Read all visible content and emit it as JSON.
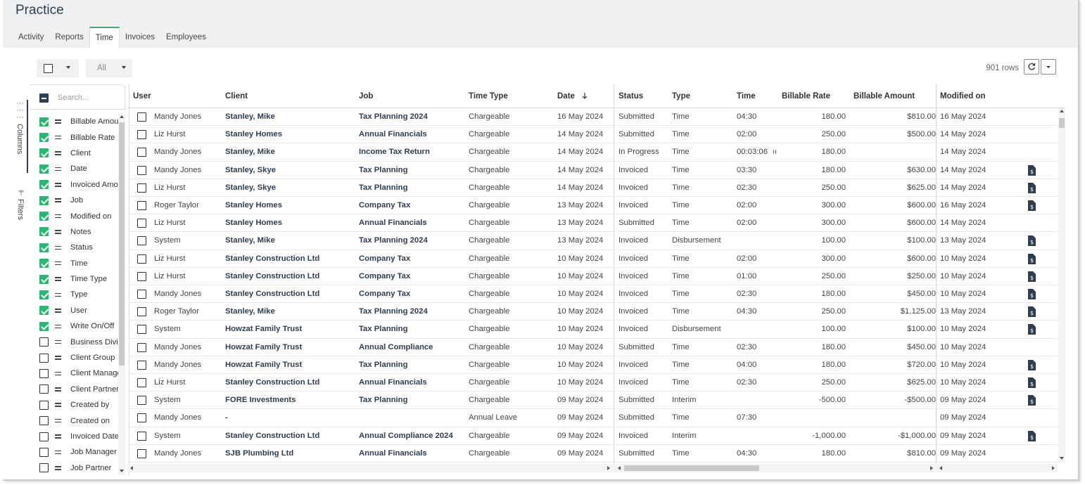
{
  "page": {
    "title": "Practice"
  },
  "tabs": [
    {
      "label": "Activity",
      "active": false
    },
    {
      "label": "Reports",
      "active": false
    },
    {
      "label": "Time",
      "active": true
    },
    {
      "label": "Invoices",
      "active": false
    },
    {
      "label": "Employees",
      "active": false
    }
  ],
  "toolbar": {
    "filter_value": "All",
    "row_count": "901 rows",
    "refresh_icon": "refresh-icon",
    "menu_icon": "chevron-down-icon"
  },
  "colors": {
    "accent_green": "#2bb673",
    "brand_navy": "#2d3e50",
    "invoice_icon": "#2d3e50"
  },
  "side_panel": {
    "columns_tab": "Columns",
    "filters_tab": "Filters",
    "search_placeholder": "Search...",
    "columns": [
      {
        "label": "Billable Amount",
        "checked": true
      },
      {
        "label": "Billable Rate",
        "checked": true
      },
      {
        "label": "Client",
        "checked": true
      },
      {
        "label": "Date",
        "checked": true
      },
      {
        "label": "Invoiced Amount",
        "checked": true
      },
      {
        "label": "Job",
        "checked": true
      },
      {
        "label": "Modified on",
        "checked": true
      },
      {
        "label": "Notes",
        "checked": true
      },
      {
        "label": "Status",
        "checked": true
      },
      {
        "label": "Time",
        "checked": true
      },
      {
        "label": "Time Type",
        "checked": true
      },
      {
        "label": "Type",
        "checked": true
      },
      {
        "label": "User",
        "checked": true
      },
      {
        "label": "Write On/Off",
        "checked": true
      },
      {
        "label": "Business Division",
        "checked": false
      },
      {
        "label": "Client Group",
        "checked": false
      },
      {
        "label": "Client Manager",
        "checked": false
      },
      {
        "label": "Client Partner",
        "checked": false
      },
      {
        "label": "Created by",
        "checked": false
      },
      {
        "label": "Created on",
        "checked": false
      },
      {
        "label": "Invoiced Date",
        "checked": false
      },
      {
        "label": "Job Manager",
        "checked": false
      },
      {
        "label": "Job Partner",
        "checked": false
      }
    ]
  },
  "table": {
    "headers": {
      "user": "User",
      "client": "Client",
      "job": "Job",
      "time_type": "Time Type",
      "date": "Date",
      "status": "Status",
      "type": "Type",
      "time": "Time",
      "billable_rate": "Billable Rate",
      "billable_amount": "Billable Amount",
      "modified_on": "Modified on"
    },
    "sort": {
      "column": "date",
      "direction": "desc"
    },
    "rows": [
      {
        "user": "Mandy Jones",
        "client": "Stanley, Mike",
        "job": "Tax Planning 2024",
        "time_type": "Chargeable",
        "date": "16 May 2024",
        "status": "Submitted",
        "type": "Time",
        "time": "04:30",
        "rate": "180.00",
        "amount": "$810.00",
        "modified": "16 May 2024",
        "invoice": false,
        "timer": false
      },
      {
        "user": "Liz Hurst",
        "client": "Stanley Homes",
        "job": "Annual Financials",
        "time_type": "Chargeable",
        "date": "14 May 2024",
        "status": "Submitted",
        "type": "Time",
        "time": "02:00",
        "rate": "250.00",
        "amount": "$500.00",
        "modified": "14 May 2024",
        "invoice": false,
        "timer": false
      },
      {
        "user": "Mandy Jones",
        "client": "Stanley, Mike",
        "job": "Income Tax Return",
        "time_type": "Chargeable",
        "date": "14 May 2024",
        "status": "In Progress",
        "type": "Time",
        "time": "00:03:06",
        "rate": "180.00",
        "amount": "",
        "modified": "14 May 2024",
        "invoice": false,
        "timer": true
      },
      {
        "user": "Mandy Jones",
        "client": "Stanley, Skye",
        "job": "Tax Planning",
        "time_type": "Chargeable",
        "date": "14 May 2024",
        "status": "Invoiced",
        "type": "Time",
        "time": "03:30",
        "rate": "180.00",
        "amount": "$630.00",
        "modified": "14 May 2024",
        "invoice": true,
        "timer": false
      },
      {
        "user": "Liz Hurst",
        "client": "Stanley, Skye",
        "job": "Tax Planning",
        "time_type": "Chargeable",
        "date": "14 May 2024",
        "status": "Invoiced",
        "type": "Time",
        "time": "02:30",
        "rate": "250.00",
        "amount": "$625.00",
        "modified": "14 May 2024",
        "invoice": true,
        "timer": false
      },
      {
        "user": "Roger Taylor",
        "client": "Stanley Homes",
        "job": "Company Tax",
        "time_type": "Chargeable",
        "date": "13 May 2024",
        "status": "Invoiced",
        "type": "Time",
        "time": "02:00",
        "rate": "300.00",
        "amount": "$600.00",
        "modified": "16 May 2024",
        "invoice": true,
        "timer": false
      },
      {
        "user": "Liz Hurst",
        "client": "Stanley Homes",
        "job": "Annual Financials",
        "time_type": "Chargeable",
        "date": "13 May 2024",
        "status": "Submitted",
        "type": "Time",
        "time": "02:00",
        "rate": "300.00",
        "amount": "$600.00",
        "modified": "14 May 2024",
        "invoice": false,
        "timer": false
      },
      {
        "user": "System",
        "client": "Stanley, Mike",
        "job": "Tax Planning 2024",
        "time_type": "Chargeable",
        "date": "13 May 2024",
        "status": "Invoiced",
        "type": "Disbursement",
        "time": "",
        "rate": "100.00",
        "amount": "$100.00",
        "modified": "13 May 2024",
        "invoice": true,
        "timer": false
      },
      {
        "user": "Liz Hurst",
        "client": "Stanley Construction Ltd",
        "job": "Company Tax",
        "time_type": "Chargeable",
        "date": "10 May 2024",
        "status": "Invoiced",
        "type": "Time",
        "time": "02:00",
        "rate": "300.00",
        "amount": "$600.00",
        "modified": "10 May 2024",
        "invoice": true,
        "timer": false
      },
      {
        "user": "Liz Hurst",
        "client": "Stanley Construction Ltd",
        "job": "Company Tax",
        "time_type": "Chargeable",
        "date": "10 May 2024",
        "status": "Invoiced",
        "type": "Time",
        "time": "01:00",
        "rate": "250.00",
        "amount": "$250.00",
        "modified": "10 May 2024",
        "invoice": true,
        "timer": false
      },
      {
        "user": "Mandy Jones",
        "client": "Stanley Construction Ltd",
        "job": "Company Tax",
        "time_type": "Chargeable",
        "date": "10 May 2024",
        "status": "Invoiced",
        "type": "Time",
        "time": "02:30",
        "rate": "180.00",
        "amount": "$450.00",
        "modified": "10 May 2024",
        "invoice": true,
        "timer": false
      },
      {
        "user": "Roger Taylor",
        "client": "Stanley, Mike",
        "job": "Tax Planning 2024",
        "time_type": "Chargeable",
        "date": "10 May 2024",
        "status": "Invoiced",
        "type": "Time",
        "time": "04:30",
        "rate": "250.00",
        "amount": "$1,125.00",
        "modified": "13 May 2024",
        "invoice": true,
        "timer": false
      },
      {
        "user": "System",
        "client": "Howzat Family Trust",
        "job": "Tax Planning",
        "time_type": "Chargeable",
        "date": "10 May 2024",
        "status": "Invoiced",
        "type": "Disbursement",
        "time": "",
        "rate": "100.00",
        "amount": "$100.00",
        "modified": "10 May 2024",
        "invoice": true,
        "timer": false
      },
      {
        "user": "Mandy Jones",
        "client": "Howzat Family Trust",
        "job": "Annual Compliance",
        "time_type": "Chargeable",
        "date": "10 May 2024",
        "status": "Submitted",
        "type": "Time",
        "time": "02:30",
        "rate": "180.00",
        "amount": "$450.00",
        "modified": "10 May 2024",
        "invoice": false,
        "timer": false
      },
      {
        "user": "Mandy Jones",
        "client": "Howzat Family Trust",
        "job": "Tax Planning",
        "time_type": "Chargeable",
        "date": "10 May 2024",
        "status": "Invoiced",
        "type": "Time",
        "time": "04:00",
        "rate": "180.00",
        "amount": "$720.00",
        "modified": "10 May 2024",
        "invoice": true,
        "timer": false
      },
      {
        "user": "Liz Hurst",
        "client": "Stanley Construction Ltd",
        "job": "Annual Financials",
        "time_type": "Chargeable",
        "date": "10 May 2024",
        "status": "Invoiced",
        "type": "Time",
        "time": "02:30",
        "rate": "250.00",
        "amount": "$625.00",
        "modified": "10 May 2024",
        "invoice": true,
        "timer": false
      },
      {
        "user": "System",
        "client": "FORE Investments",
        "job": "Tax Planning",
        "time_type": "Chargeable",
        "date": "09 May 2024",
        "status": "Submitted",
        "type": "Interim",
        "time": "",
        "rate": "-500.00",
        "amount": "-$500.00",
        "modified": "09 May 2024",
        "invoice": true,
        "timer": false
      },
      {
        "user": "Mandy Jones",
        "client": "-",
        "job": "",
        "time_type": "Annual Leave",
        "date": "09 May 2024",
        "status": "Submitted",
        "type": "Time",
        "time": "07:30",
        "rate": "",
        "amount": "",
        "modified": "09 May 2024",
        "invoice": false,
        "timer": false
      },
      {
        "user": "System",
        "client": "Stanley Construction Ltd",
        "job": "Annual Compliance 2024",
        "time_type": "Chargeable",
        "date": "09 May 2024",
        "status": "Invoiced",
        "type": "Interim",
        "time": "",
        "rate": "-1,000.00",
        "amount": "-$1,000.00",
        "modified": "09 May 2024",
        "invoice": true,
        "timer": false
      },
      {
        "user": "Mandy Jones",
        "client": "SJB Plumbing Ltd",
        "job": "Annual Financials",
        "time_type": "Chargeable",
        "date": "09 May 2024",
        "status": "Submitted",
        "type": "Time",
        "time": "04:30",
        "rate": "180.00",
        "amount": "$810.00",
        "modified": "09 May 2024",
        "invoice": false,
        "timer": false
      }
    ]
  }
}
